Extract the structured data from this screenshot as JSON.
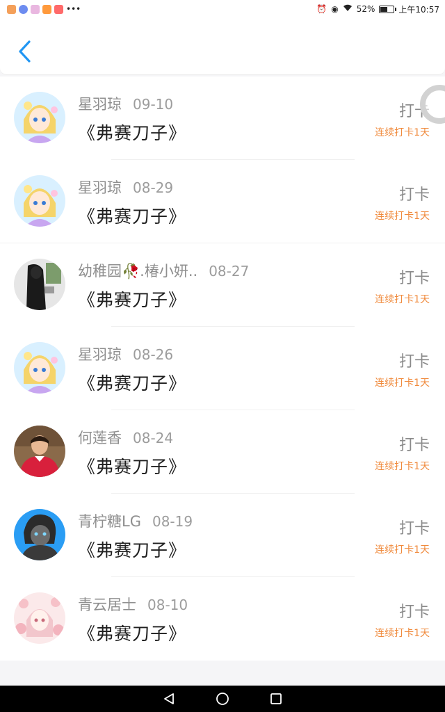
{
  "status_bar": {
    "battery": "52%",
    "time": "上午10:57",
    "battery_level": 0.52
  },
  "header": {
    "back_icon": "chevron-left-icon",
    "accent_color": "#2196f3"
  },
  "entries": [
    {
      "user": "星羽琼",
      "date": "09-10",
      "book": "《弗赛刀子》",
      "action": "打卡",
      "streak": "连续打卡1天"
    },
    {
      "user": "星羽琼",
      "date": "08-29",
      "book": "《弗赛刀子》",
      "action": "打卡",
      "streak": "连续打卡1天"
    },
    {
      "user": "幼稚园🥀.椿小妍..",
      "date": "08-27",
      "book": "《弗赛刀子》",
      "action": "打卡",
      "streak": "连续打卡1天"
    },
    {
      "user": "星羽琼",
      "date": "08-26",
      "book": "《弗赛刀子》",
      "action": "打卡",
      "streak": "连续打卡1天"
    },
    {
      "user": "何莲香",
      "date": "08-24",
      "book": "《弗赛刀子》",
      "action": "打卡",
      "streak": "连续打卡1天"
    },
    {
      "user": "青柠糖LG",
      "date": "08-19",
      "book": "《弗赛刀子》",
      "action": "打卡",
      "streak": "连续打卡1天"
    },
    {
      "user": "青云居士",
      "date": "08-10",
      "book": "《弗赛刀子》",
      "action": "打卡",
      "streak": "连续打卡1天"
    }
  ],
  "colors": {
    "streak": "#f08a3c",
    "name": "#8f8f8f",
    "book": "#1f1f1f"
  },
  "nav": {
    "back_icon": "triangle-back-icon",
    "home_icon": "circle-home-icon",
    "recents_icon": "square-recents-icon"
  }
}
